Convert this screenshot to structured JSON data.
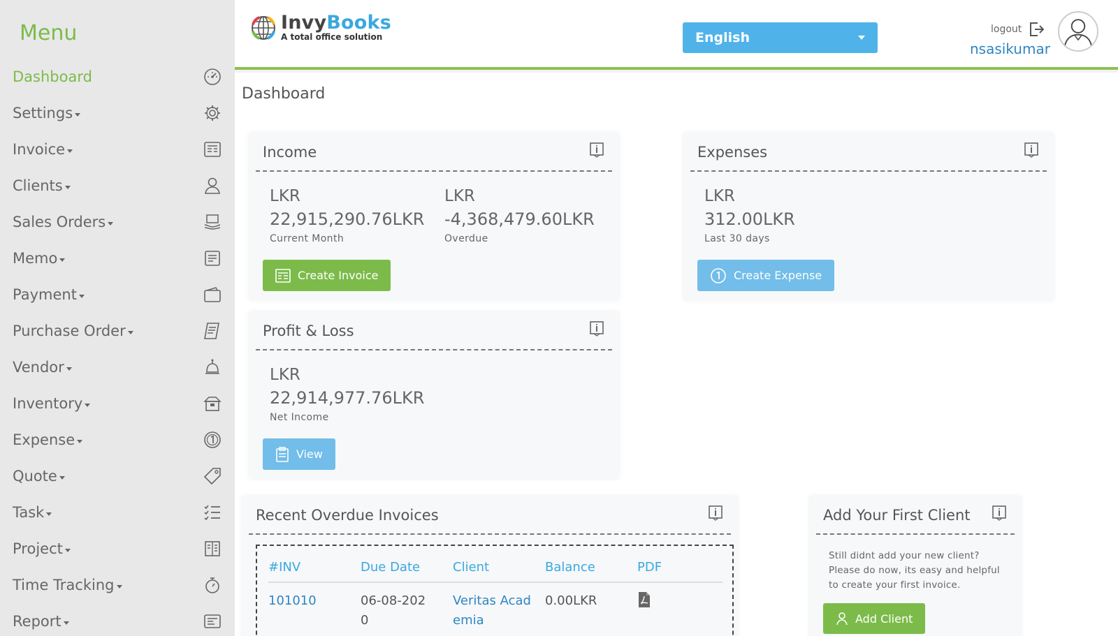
{
  "sidebar": {
    "title": "Menu",
    "items": [
      {
        "label": "Dashboard",
        "icon": "dashboard-gauge-icon",
        "active": true,
        "caret": false
      },
      {
        "label": "Settings",
        "icon": "gear-icon",
        "caret": true
      },
      {
        "label": "Invoice",
        "icon": "invoice-icon",
        "caret": true
      },
      {
        "label": "Clients",
        "icon": "user-icon",
        "caret": true
      },
      {
        "label": "Sales Orders",
        "icon": "sales-order-icon",
        "caret": true
      },
      {
        "label": "Memo",
        "icon": "memo-icon",
        "caret": true
      },
      {
        "label": "Payment",
        "icon": "wallet-icon",
        "caret": true
      },
      {
        "label": "Purchase Order",
        "icon": "purchase-order-icon",
        "caret": true
      },
      {
        "label": "Vendor",
        "icon": "vendor-icon",
        "caret": true
      },
      {
        "label": "Inventory",
        "icon": "inventory-box-icon",
        "caret": true
      },
      {
        "label": "Expense",
        "icon": "coin-icon",
        "caret": true
      },
      {
        "label": "Quote",
        "icon": "tag-icon",
        "caret": true
      },
      {
        "label": "Task",
        "icon": "checklist-icon",
        "caret": true
      },
      {
        "label": "Project",
        "icon": "project-icon",
        "caret": true
      },
      {
        "label": "Time Tracking",
        "icon": "stopwatch-icon",
        "caret": true
      },
      {
        "label": "Report",
        "icon": "report-icon",
        "caret": true
      }
    ]
  },
  "header": {
    "brand_part1": "Invy",
    "brand_part2": "Books",
    "tagline": "A total office solution",
    "language": "English",
    "logout_label": "logout",
    "username": "nsasikumar"
  },
  "page": {
    "title": "Dashboard"
  },
  "income": {
    "title": "Income",
    "current": {
      "currency": "LKR",
      "value": "22,915,290.76LKR",
      "label": "Current Month"
    },
    "overdue": {
      "currency": "LKR",
      "value": "-4,368,479.60LKR",
      "label": "Overdue"
    },
    "button": "Create Invoice"
  },
  "expenses": {
    "title": "Expenses",
    "currency": "LKR",
    "value": "312.00LKR",
    "label": "Last 30 days",
    "button": "Create Expense"
  },
  "profit_loss": {
    "title": "Profit & Loss",
    "currency": "LKR",
    "value": "22,914,977.76LKR",
    "label": "Net Income",
    "button": "View"
  },
  "overdue_invoices": {
    "title": "Recent Overdue Invoices",
    "columns": [
      "#INV",
      "Due Date",
      "Client",
      "Balance",
      "PDF"
    ],
    "rows": [
      {
        "inv": "101010",
        "due_date_line1": "06-08-202",
        "due_date_line2": "0",
        "client_line1": "Veritas Acad",
        "client_line2": "emia",
        "balance": "0.00LKR"
      }
    ]
  },
  "first_client": {
    "title": "Add Your First Client",
    "text_line1": "Still didnt add your new client?",
    "text_line2": "Please do now, its easy and helpful",
    "text_line3": "to create your first invoice.",
    "button": "Add Client"
  },
  "colors": {
    "accent_green": "#7cbb4a",
    "accent_blue": "#4fb3ea",
    "link_blue": "#2e86c1"
  }
}
